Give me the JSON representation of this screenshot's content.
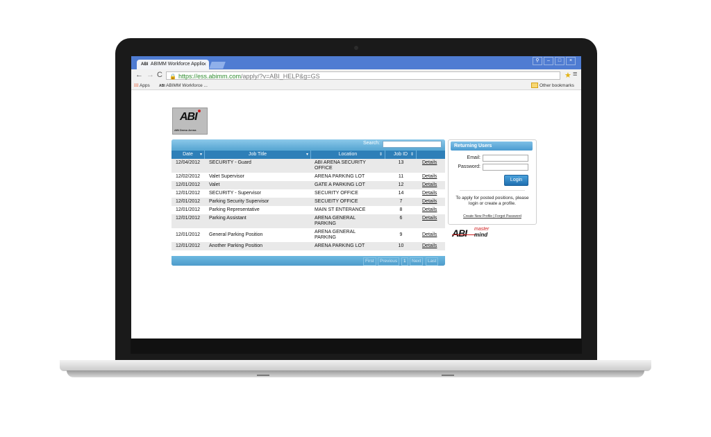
{
  "browser": {
    "tab_title": "ABIMM Workforce Applic",
    "tab_logo": "ABI",
    "tab_close": "×",
    "win_minimize": "–",
    "win_restore": "□",
    "win_close": "×",
    "win_user": "⚲",
    "url_secure": "https://ess.abimm.com",
    "url_path": "/apply/?v=ABI_HELP&g=GS",
    "bookmark_apps": "Apps",
    "bookmark_1": "ABIMM Workforce ...",
    "other_bookmarks": "Other bookmarks"
  },
  "logo": {
    "abi": "ABI",
    "tagline": "ABI Demo Arena"
  },
  "grid": {
    "search_label": "Search:",
    "headers": {
      "date": "Date",
      "title": "Job Title",
      "location": "Location",
      "jobid": "Job ID"
    },
    "rows": [
      {
        "date": "12/04/2012",
        "title": "SECURITY - Guard",
        "location": "ABI ARENA SECURITY OFFICE",
        "jobid": "13",
        "details": "Details"
      },
      {
        "date": "12/02/2012",
        "title": "Valet Supervisor",
        "location": "ARENA PARKING LOT",
        "jobid": "11",
        "details": "Details"
      },
      {
        "date": "12/01/2012",
        "title": "Valet",
        "location": "GATE A PARKING LOT",
        "jobid": "12",
        "details": "Details"
      },
      {
        "date": "12/01/2012",
        "title": "SECURITY - Supervisor",
        "location": "SECURITY OFFICE",
        "jobid": "14",
        "details": "Details"
      },
      {
        "date": "12/01/2012",
        "title": "Parking Security Supervisor",
        "location": "SECUEITY OFFICE",
        "jobid": "7",
        "details": "Details"
      },
      {
        "date": "12/01/2012",
        "title": "Parking Representative",
        "location": "MAIN ST ENTERANCE",
        "jobid": "8",
        "details": "Details"
      },
      {
        "date": "12/01/2012",
        "title": "Parking Assistant",
        "location": "ARENA GENERAL PARKING",
        "jobid": "6",
        "details": "Details"
      },
      {
        "date": "12/01/2012",
        "title": "General Parking Position",
        "location": "ARENA GENERAL PARKING",
        "jobid": "9",
        "details": "Details"
      },
      {
        "date": "12/01/2012",
        "title": "Another Parking Position",
        "location": "ARENA PARKING LOT",
        "jobid": "10",
        "details": "Details"
      }
    ],
    "pager": {
      "first": "First",
      "previous": "Previous",
      "page": "1",
      "next": "Next",
      "last": "Last"
    }
  },
  "login": {
    "title": "Returning Users",
    "email_label": "Email:",
    "password_label": "Password:",
    "button": "Login",
    "message": "To apply for posted positions, please login or create a profile.",
    "links": "Create New Profile | Forgot Password"
  },
  "mastermind": {
    "abi": "ABI",
    "master": "master",
    "mind": "mind"
  }
}
